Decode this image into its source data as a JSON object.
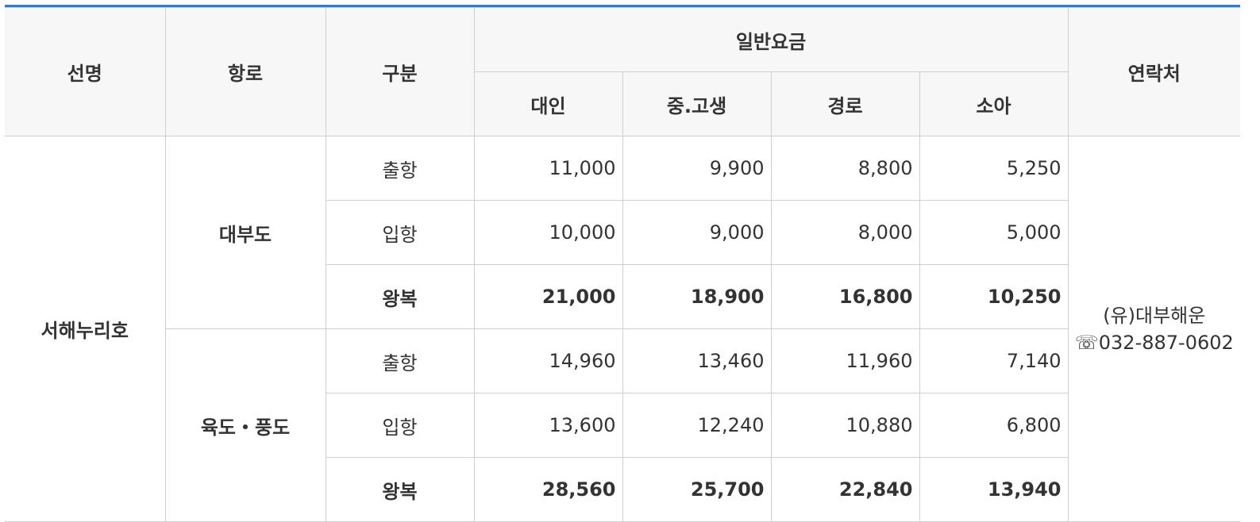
{
  "table": {
    "headers": {
      "ship": "선명",
      "route": "항로",
      "kind": "구분",
      "fare_group": "일반요금",
      "contact": "연락처",
      "fare_cols": [
        "대인",
        "중.고생",
        "경로",
        "소아"
      ]
    },
    "ship_name": "서해누리호",
    "routes": [
      {
        "name": "대부도",
        "rows": [
          {
            "kind": "출항",
            "values": [
              "11,000",
              "9,900",
              "8,800",
              "5,250"
            ]
          },
          {
            "kind": "입항",
            "values": [
              "10,000",
              "9,000",
              "8,000",
              "5,000"
            ]
          },
          {
            "kind": "왕복",
            "values": [
              "21,000",
              "18,900",
              "16,800",
              "10,250"
            ]
          }
        ]
      },
      {
        "name": "육도・풍도",
        "rows": [
          {
            "kind": "출항",
            "values": [
              "14,960",
              "13,460",
              "11,960",
              "7,140"
            ]
          },
          {
            "kind": "입항",
            "values": [
              "13,600",
              "12,240",
              "10,880",
              "6,800"
            ]
          },
          {
            "kind": "왕복",
            "values": [
              "28,560",
              "25,700",
              "22,840",
              "13,940"
            ]
          }
        ]
      }
    ],
    "contact": {
      "company": "(유)대부해운",
      "phone": "☏032-887-0602"
    }
  }
}
